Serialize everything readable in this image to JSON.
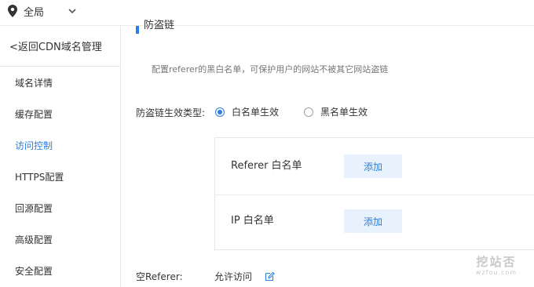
{
  "topbar": {
    "region_label": "全局",
    "icons": {
      "location": "map-pin-icon",
      "dropdown": "chevron-down-icon"
    }
  },
  "sidebar": {
    "back_link": "<返回CDN域名管理",
    "items": [
      {
        "label": "域名详情",
        "active": false
      },
      {
        "label": "缓存配置",
        "active": false
      },
      {
        "label": "访问控制",
        "active": true
      },
      {
        "label": "HTTPS配置",
        "active": false
      },
      {
        "label": "回源配置",
        "active": false
      },
      {
        "label": "高级配置",
        "active": false
      },
      {
        "label": "安全配置",
        "active": false
      }
    ]
  },
  "main": {
    "section_title": "防盗链",
    "description": "配置referer的黑白名单，可保护用户的网站不被其它网站盗链",
    "type_label": "防盗链生效类型:",
    "radio_options": [
      {
        "label": "白名单生效",
        "selected": true
      },
      {
        "label": "黑名单生效",
        "selected": false
      }
    ],
    "lists": [
      {
        "label": "Referer 白名单",
        "add_label": "添加"
      },
      {
        "label": "IP 白名单",
        "add_label": "添加"
      }
    ],
    "empty_referer": {
      "label": "空Referer:",
      "value": "允许访问",
      "edit_icon": "edit-icon"
    }
  },
  "watermark": {
    "main": "挖站否",
    "sub": "wzfou.com"
  },
  "colors": {
    "accent": "#2b7de1",
    "button_bg": "#e8f2fc",
    "border": "#e6e6e6",
    "watermark": "#c9c9c9"
  }
}
